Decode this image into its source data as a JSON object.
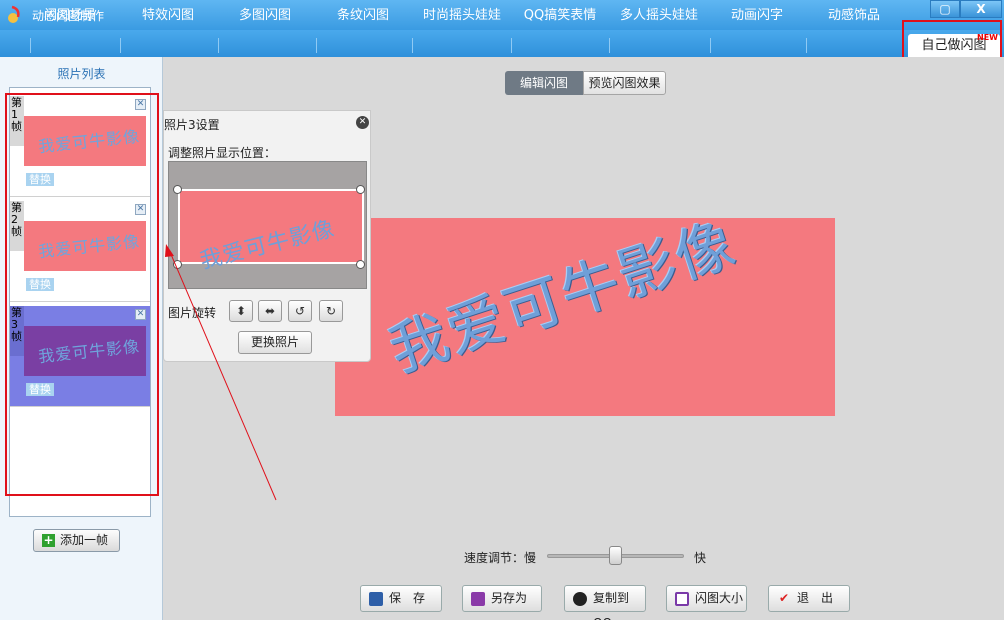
{
  "app": {
    "title": "动感闪图制作"
  },
  "window": {
    "maximize_icon": "maximize-icon",
    "close_icon": "close-icon"
  },
  "tabs": [
    {
      "label": "闪图场景"
    },
    {
      "label": "特效闪图"
    },
    {
      "label": "多图闪图"
    },
    {
      "label": "条纹闪图"
    },
    {
      "label": "时尚摇头娃娃"
    },
    {
      "label": "QQ搞笑表情"
    },
    {
      "label": "多人摇头娃娃"
    },
    {
      "label": "动画闪字"
    },
    {
      "label": "动感饰品"
    },
    {
      "label": "自己做闪图",
      "active": true,
      "badge": "NEW"
    }
  ],
  "left_panel": {
    "title": "照片列表",
    "frames": [
      {
        "label": "第1帧",
        "thumb_text": "我爱可牛影像",
        "replace": "替换",
        "selected": false
      },
      {
        "label": "第2帧",
        "thumb_text": "我爱可牛影像",
        "replace": "替换",
        "selected": false
      },
      {
        "label": "第3帧",
        "thumb_text": "我爱可牛影像",
        "replace": "替换",
        "selected": true
      }
    ],
    "add_button": "添加一帧"
  },
  "view_toggle": {
    "edit": "编辑闪图",
    "preview": "预览闪图效果",
    "active": "edit"
  },
  "canvas": {
    "text": "我爱可牛影像",
    "bg_color": "#f4797f"
  },
  "popup": {
    "title": "照片3设置",
    "position_label": "调整照片显示位置：",
    "preview_text": "我爱可牛影像",
    "rotate_label": "图片旋转",
    "rotate_buttons": [
      "flip-vertical-icon",
      "flip-horizontal-icon",
      "rotate-left-icon",
      "rotate-right-icon"
    ],
    "replace_button": "更换照片"
  },
  "speed": {
    "label": "速度调节：慢",
    "fast": "快",
    "value": 0.47
  },
  "bottom_buttons": [
    {
      "label": "保　存",
      "icon": "save-icon"
    },
    {
      "label": "另存为",
      "icon": "save-as-icon"
    },
    {
      "label": "复制到QQ",
      "icon": "qq-icon"
    },
    {
      "label": "闪图大小",
      "icon": "resize-icon"
    },
    {
      "label": "退　出",
      "icon": "exit-icon"
    }
  ],
  "colors": {
    "accent": "#3a9be2",
    "highlight": "#e0101a",
    "selected_frame": "#7a7ee4"
  }
}
